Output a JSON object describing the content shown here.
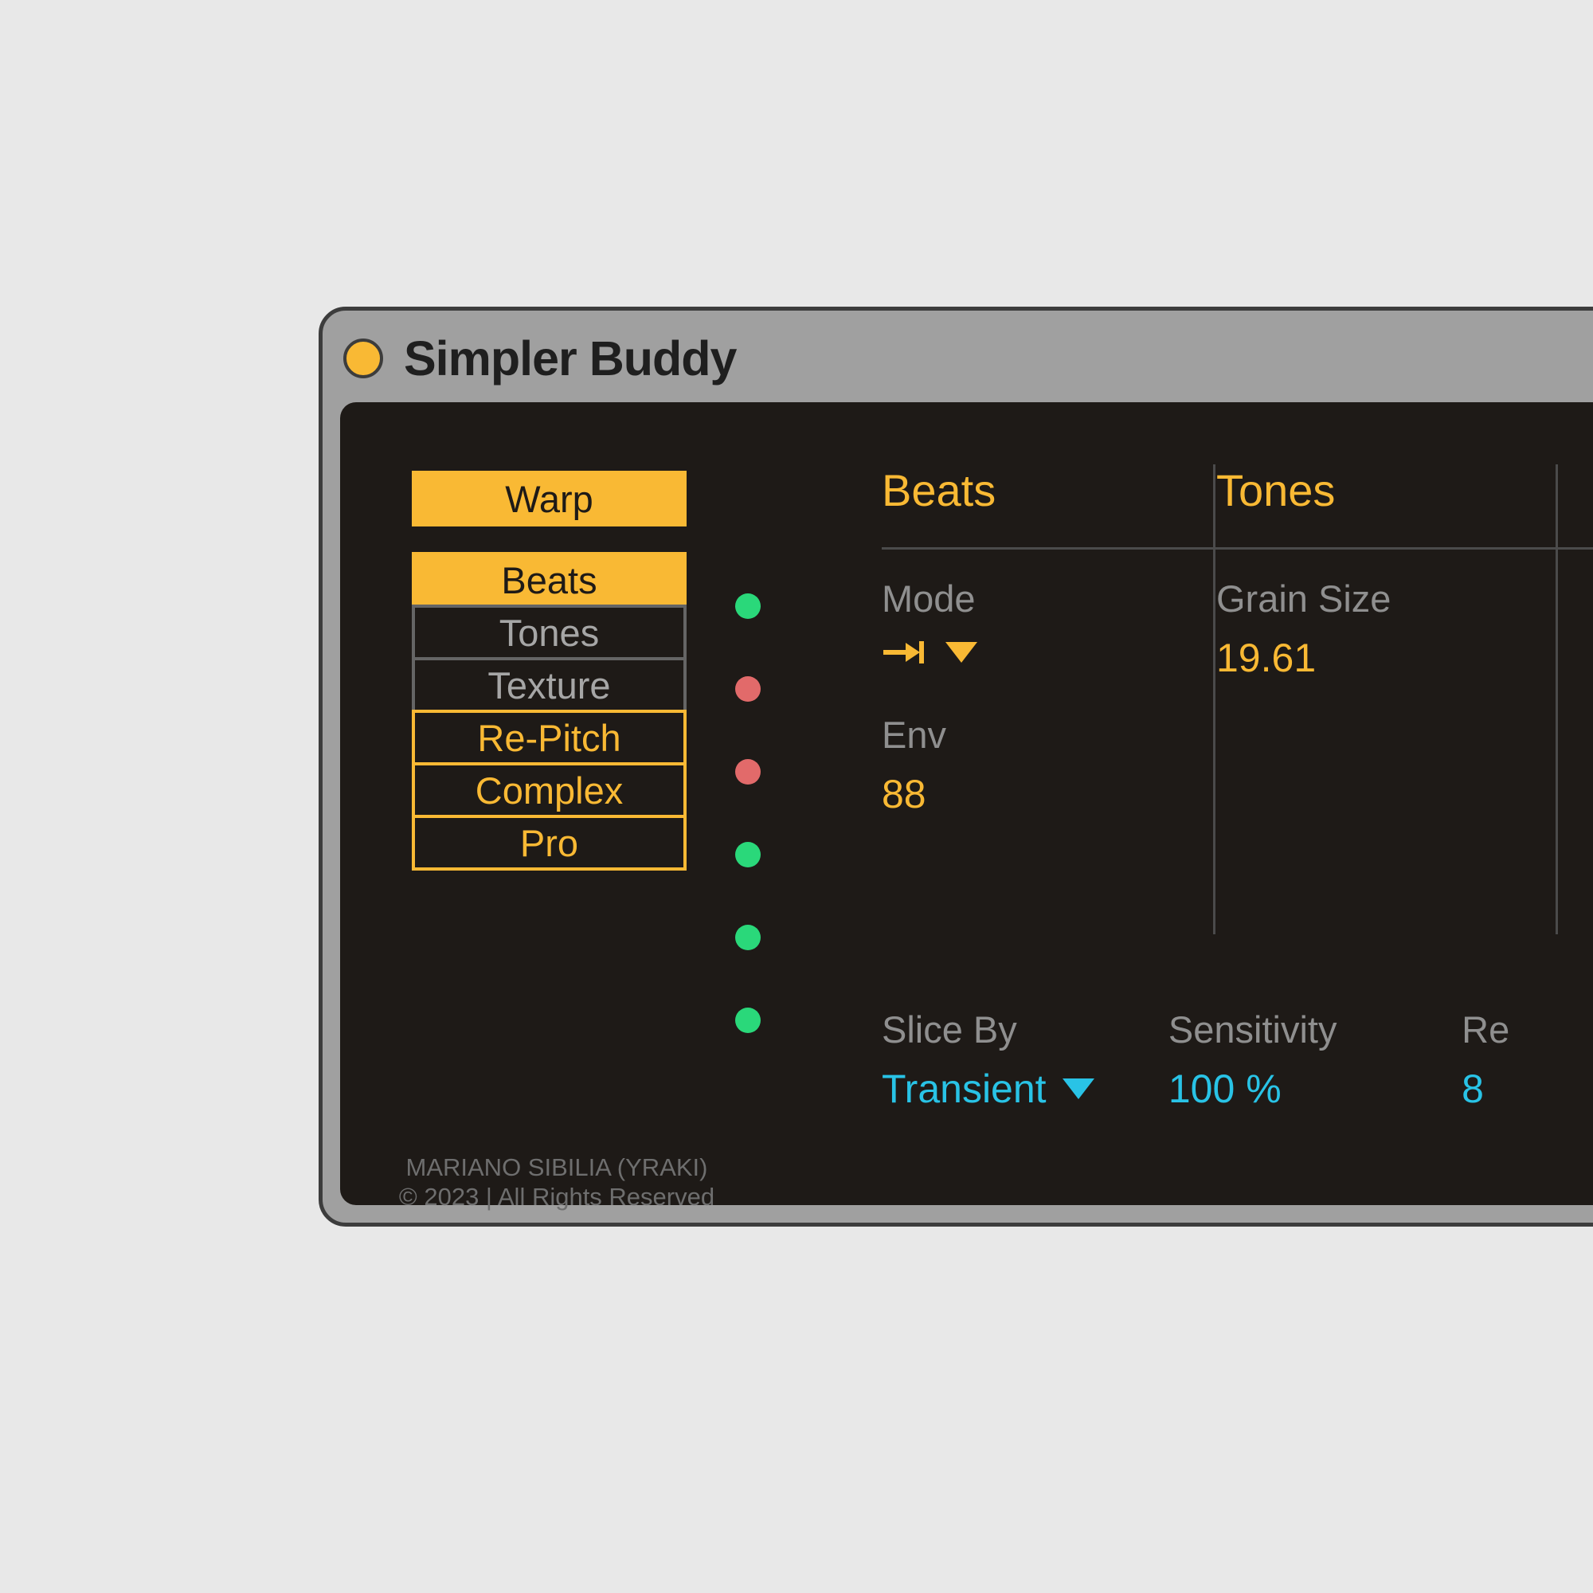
{
  "window": {
    "title": "Simpler Buddy"
  },
  "sidebar": {
    "warp": "Warp",
    "modes": [
      {
        "label": "Beats",
        "style": "solid",
        "led": "green"
      },
      {
        "label": "Tones",
        "style": "outline-grey",
        "led": "red"
      },
      {
        "label": "Texture",
        "style": "outline-grey",
        "led": "red"
      },
      {
        "label": "Re-Pitch",
        "style": "outline-orange",
        "led": "green"
      },
      {
        "label": "Complex",
        "style": "outline-orange",
        "led": "green"
      },
      {
        "label": "Pro",
        "style": "outline-orange",
        "led": "green"
      }
    ]
  },
  "columns": {
    "beats": {
      "heading": "Beats",
      "mode_label": "Mode",
      "env_label": "Env",
      "env_value": "88"
    },
    "tones": {
      "heading": "Tones",
      "grain_label": "Grain Size",
      "grain_value": "19.61"
    }
  },
  "bottom": {
    "sliceby_label": "Slice By",
    "sliceby_value": "Transient",
    "sensitivity_label": "Sensitivity",
    "sensitivity_value": "100 %",
    "regions_label": "Re",
    "regions_value": "8"
  },
  "credits": {
    "line1": "MARIANO SIBILIA (YRAKI)",
    "line2": "© 2023 | All Rights Reserved"
  }
}
